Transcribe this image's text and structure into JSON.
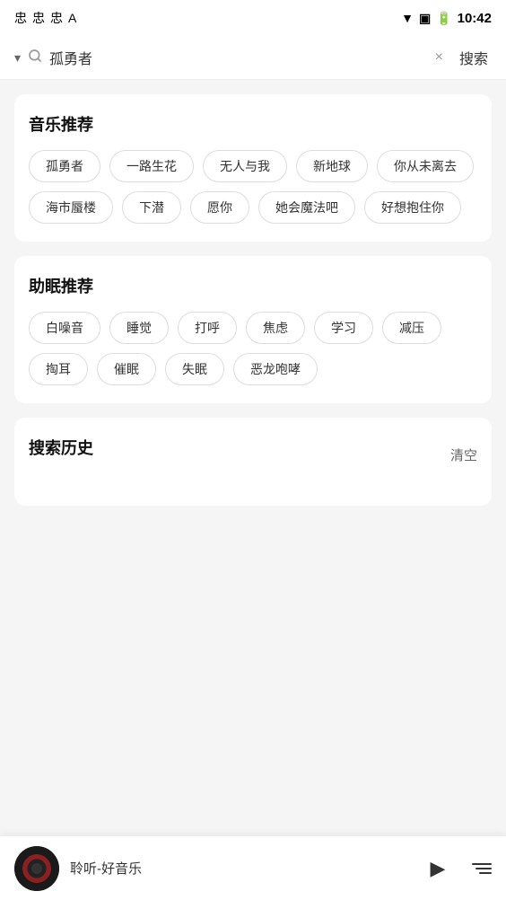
{
  "statusBar": {
    "time": "10:42",
    "icons": [
      "忠",
      "忠",
      "忠",
      "A"
    ]
  },
  "searchBar": {
    "value": "孤勇者",
    "placeholder": "搜索",
    "searchButtonLabel": "搜索",
    "clearLabel": "×"
  },
  "musicSection": {
    "title": "音乐推荐",
    "tags": [
      "孤勇者",
      "一路生花",
      "无人与我",
      "新地球",
      "你从未离去",
      "海市蜃楼",
      "下潜",
      "愿你",
      "她会魔法吧",
      "好想抱住你"
    ]
  },
  "sleepSection": {
    "title": "助眠推荐",
    "tags": [
      "白噪音",
      "睡觉",
      "打呼",
      "焦虑",
      "学习",
      "减压",
      "掏耳",
      "催眠",
      "失眠",
      "恶龙咆哮"
    ]
  },
  "historySection": {
    "title": "搜索历史",
    "clearLabel": "清空",
    "tags": []
  },
  "player": {
    "title": "聆听-好音乐",
    "playIcon": "▶",
    "playlistLabel": "playlist"
  }
}
